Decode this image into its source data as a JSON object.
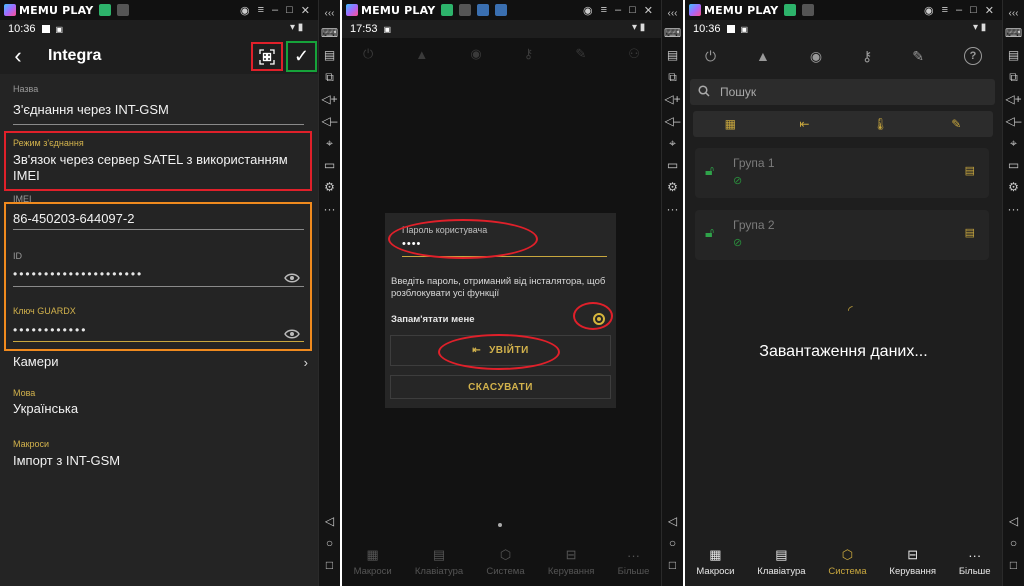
{
  "emulator": {
    "brand": "MEMU PLAY"
  },
  "panel1": {
    "time": "10:36",
    "title": "Integra",
    "fields": {
      "name": {
        "label": "Назва",
        "value": "З'єднання через INT-GSM"
      },
      "mode": {
        "label": "Режим з'єднання",
        "value_line1": "Зв'язок через сервер SATEL з використанням",
        "value_line2": "IMEI"
      },
      "imei": {
        "label": "IMEI",
        "value": "86-450203-644097-2"
      },
      "id": {
        "label": "ID",
        "value": "•••••••••••••••••••••"
      },
      "key": {
        "label": "Ключ GUARDX",
        "value": "••••••••••••"
      },
      "cameras": {
        "label": "Камери"
      },
      "language": {
        "label": "Мова",
        "value": "Українська"
      },
      "macros": {
        "label": "Макроси",
        "value": "Імпорт з INT-GSM"
      }
    }
  },
  "panel2": {
    "time": "17:53",
    "dialog": {
      "password_label": "Пароль користувача",
      "password_value": "••••",
      "info": "Введіть пароль, отриманий від інсталятора, щоб розблокувати усі функції",
      "remember": "Запам'ятати мене",
      "login": "УВІЙТИ",
      "cancel": "СКАСУВАТИ"
    },
    "nav": [
      "Макроси",
      "Клавіатура",
      "Система",
      "Керування",
      "Більше"
    ]
  },
  "panel3": {
    "time": "10:36",
    "search_placeholder": "Пошук",
    "help": "?",
    "groups": [
      {
        "name": "Група 1"
      },
      {
        "name": "Група 2"
      }
    ],
    "loading": "Завантаження даних...",
    "nav": [
      "Макроси",
      "Клавіатура",
      "Система",
      "Керування",
      "Більше"
    ],
    "active_nav": "Система"
  },
  "colors": {
    "accent": "#c8a73e",
    "red_mark": "#e0202a",
    "green_mark": "#16a33a",
    "orange_mark": "#f08a1e",
    "lock_green": "#2fa34a"
  }
}
